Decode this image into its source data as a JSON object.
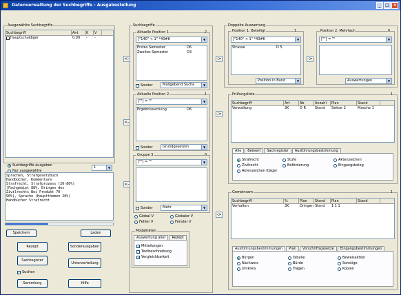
{
  "title": "Datenverwaltung der Suchbegriffe - Ausgabestellung",
  "window_buttons": {
    "min": "_",
    "max": "□",
    "close": "×"
  },
  "left": {
    "group_label": "Ausgewählte Suchbegriffe",
    "columns": [
      "Suchbegriff",
      "Ant",
      "K",
      "V"
    ],
    "rows": [
      {
        "name": "Hauptschuldiger",
        "ant": "0,00",
        "k": "-",
        "v": "-"
      }
    ],
    "radio1": "Suchbegriffe ausgeben",
    "radio2": "Nur ausgewählte",
    "spin_value": "1",
    "text_lines": [
      "Sprachen, Strafgesetzbuch",
      "Handbücher, Kommentare",
      "Strafrecht, Strafprozess (20-80%)",
      "(Fachgebiet 88%, Bringen des",
      "Zivilrechts Bei Produkt 70-",
      "90%), Sprache (Hauptthemen 20%)",
      "Handbücher Strafrecht"
    ],
    "progress": 0.4,
    "btn_save": "Speichern",
    "btn_load": "Laden",
    "btn_rezept": "Rezept",
    "btn_sonder": "Sonderausgaben",
    "btn_sachregister": "Sachregister",
    "btn_unterverteilung": "Unterverteilung",
    "chk_suche": "Suchen",
    "btn_sammlung": "Sammlung",
    "btn_hilfe": "Hilfe"
  },
  "col2": {
    "group_label": "Suchbegriffe",
    "sub1_label": "Aktuelle Position 1",
    "sub1_count": "2",
    "combo1": "[\"140\" < 1\" *40#K",
    "list1": [
      {
        "a": "Erstes Semester",
        "b": "D6"
      },
      {
        "a": "Zweites Semester",
        "b": "D3"
      }
    ],
    "chk1": "Sonder",
    "combo1b": "Maßgebend Suche",
    "sub2_label": "Aktuelle Position 2",
    "sub2_count": "1",
    "combo2": "[\"\"] = \"\"",
    "list2": [
      {
        "a": "Ergebnissuchung",
        "b": "D6"
      }
    ],
    "chk2": "Sonder",
    "combo2b": "Grundgesetzen",
    "sub3_label": "Gruppe 3",
    "sub3_count": "0",
    "combo3": "[\"\"] = \"\"",
    "chk3": "Sonder",
    "combo3b": "Mehr",
    "radios": [
      "Global V",
      "Globaler V",
      "Fehler V",
      "Fenster V"
    ],
    "sub4_label": "Modalitäten",
    "tabs": [
      "Auswertung aller",
      "Rezept"
    ],
    "checks": [
      "Mitteilungen",
      "Textbeschreibung",
      "Vergleichbarkeit"
    ]
  },
  "col3": {
    "group_label": "Doppelte Auswertung",
    "sub1_label": "Position 1, Beteiligt",
    "sub1_count": "1",
    "combo1": "[\"140\" < 1\" *40#K",
    "list1": [
      {
        "a": "Strasse",
        "b": "D 5"
      }
    ],
    "combo1b": "Position in Bund",
    "sub2_label": "Position 2, Mehrfach",
    "sub2_count": "0",
    "combo2": "[\"\"] = \"\"",
    "combo2b": "Auswertungen"
  },
  "mid": {
    "group_label": "Prüfungsliste",
    "count": "1",
    "columns": [
      "Suchbegriff",
      "Art",
      "Ab",
      "Anzahl",
      "Plan",
      "Stand"
    ],
    "rows": [
      {
        "c": [
          "Verwaltung",
          "3K",
          "D R",
          "Stand",
          "Sektor 2",
          "Masche 1"
        ]
      }
    ],
    "tabs": [
      "Alle",
      "Beiwert",
      "Sachregister",
      "Ausführungsbestimmung"
    ],
    "radios": [
      "Strafrecht",
      "Stufe",
      "Aktenzeichen",
      "Zivilrecht",
      "Beförderung",
      "Eingangsbeleg",
      "Aktenzeichen Kläger"
    ]
  },
  "bot": {
    "group_label": "Gemeinsam",
    "count": "1",
    "columns": [
      "Suchbegriff",
      "%",
      "Plan",
      "Stand",
      "Plan",
      "Stand"
    ],
    "rows": [
      {
        "c": [
          "Verhalten",
          "3K",
          "Dringen",
          "Stand",
          "1 1 1",
          ""
        ]
      }
    ],
    "tabs": [
      "Ausführungsbestimmungen",
      "Plan",
      "Vorschriftsgesetze",
      "Eingangsbestimmungen"
    ],
    "radios": [
      "Bürgen",
      "Tabelle",
      "Beweisaktion",
      "Nachweis",
      "Bürde",
      "Sonstige",
      "Umkreis",
      "Tragen",
      "Kopien"
    ]
  },
  "arrows": {
    "right": "->",
    "left": "<-"
  }
}
